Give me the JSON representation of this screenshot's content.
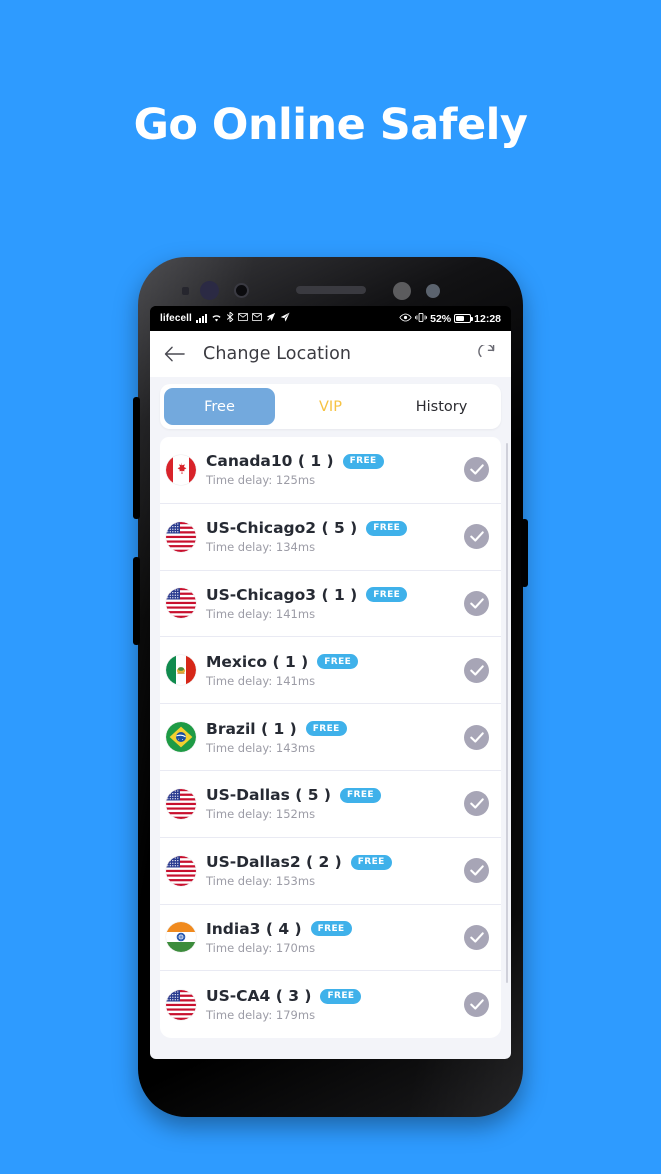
{
  "headline": {
    "text": "Go Online Safely"
  },
  "status_bar": {
    "carrier": "lifecell",
    "icons_left": [
      "signal-bars",
      "wifi",
      "bluetooth",
      "mail",
      "mail",
      "location-arrow",
      "send"
    ],
    "icons_right": [
      "eye",
      "vibrate"
    ],
    "battery_percent": "52%",
    "time": "12:28"
  },
  "app_bar": {
    "back_icon": "back-arrow-icon",
    "title": "Change Location",
    "refresh_icon": "refresh-icon"
  },
  "tabs": [
    {
      "label": "Free",
      "state": "active"
    },
    {
      "label": "VIP",
      "state": "vip"
    },
    {
      "label": "History",
      "state": "plain"
    }
  ],
  "delay_prefix": "Time delay: ",
  "servers": [
    {
      "flag": "ca",
      "name": "Canada10 ( 1 )",
      "badge": "FREE",
      "delay": "Time delay: 125ms",
      "selected_icon": "check-circle-icon"
    },
    {
      "flag": "us",
      "name": "US-Chicago2 ( 5 )",
      "badge": "FREE",
      "delay": "Time delay: 134ms",
      "selected_icon": "check-circle-icon"
    },
    {
      "flag": "us",
      "name": "US-Chicago3 ( 1 )",
      "badge": "FREE",
      "delay": "Time delay: 141ms",
      "selected_icon": "check-circle-icon"
    },
    {
      "flag": "mx",
      "name": "Mexico ( 1 )",
      "badge": "FREE",
      "delay": "Time delay: 141ms",
      "selected_icon": "check-circle-icon"
    },
    {
      "flag": "br",
      "name": "Brazil ( 1 )",
      "badge": "FREE",
      "delay": "Time delay: 143ms",
      "selected_icon": "check-circle-icon"
    },
    {
      "flag": "us",
      "name": "US-Dallas ( 5 )",
      "badge": "FREE",
      "delay": "Time delay: 152ms",
      "selected_icon": "check-circle-icon"
    },
    {
      "flag": "us",
      "name": "US-Dallas2 ( 2 )",
      "badge": "FREE",
      "delay": "Time delay: 153ms",
      "selected_icon": "check-circle-icon"
    },
    {
      "flag": "in",
      "name": "India3 ( 4 )",
      "badge": "FREE",
      "delay": "Time delay: 170ms",
      "selected_icon": "check-circle-icon"
    },
    {
      "flag": "us",
      "name": "US-CA4 ( 3 )",
      "badge": "FREE",
      "delay": "Time delay: 179ms",
      "selected_icon": "check-circle-icon"
    }
  ],
  "colors": {
    "background": "#2E9BFF",
    "tab_active": "#73A9DD",
    "tab_vip": "#F6C343",
    "badge": "#3FB1EA",
    "check": "#A7A5B6",
    "app_bg": "#f3f4f9"
  }
}
